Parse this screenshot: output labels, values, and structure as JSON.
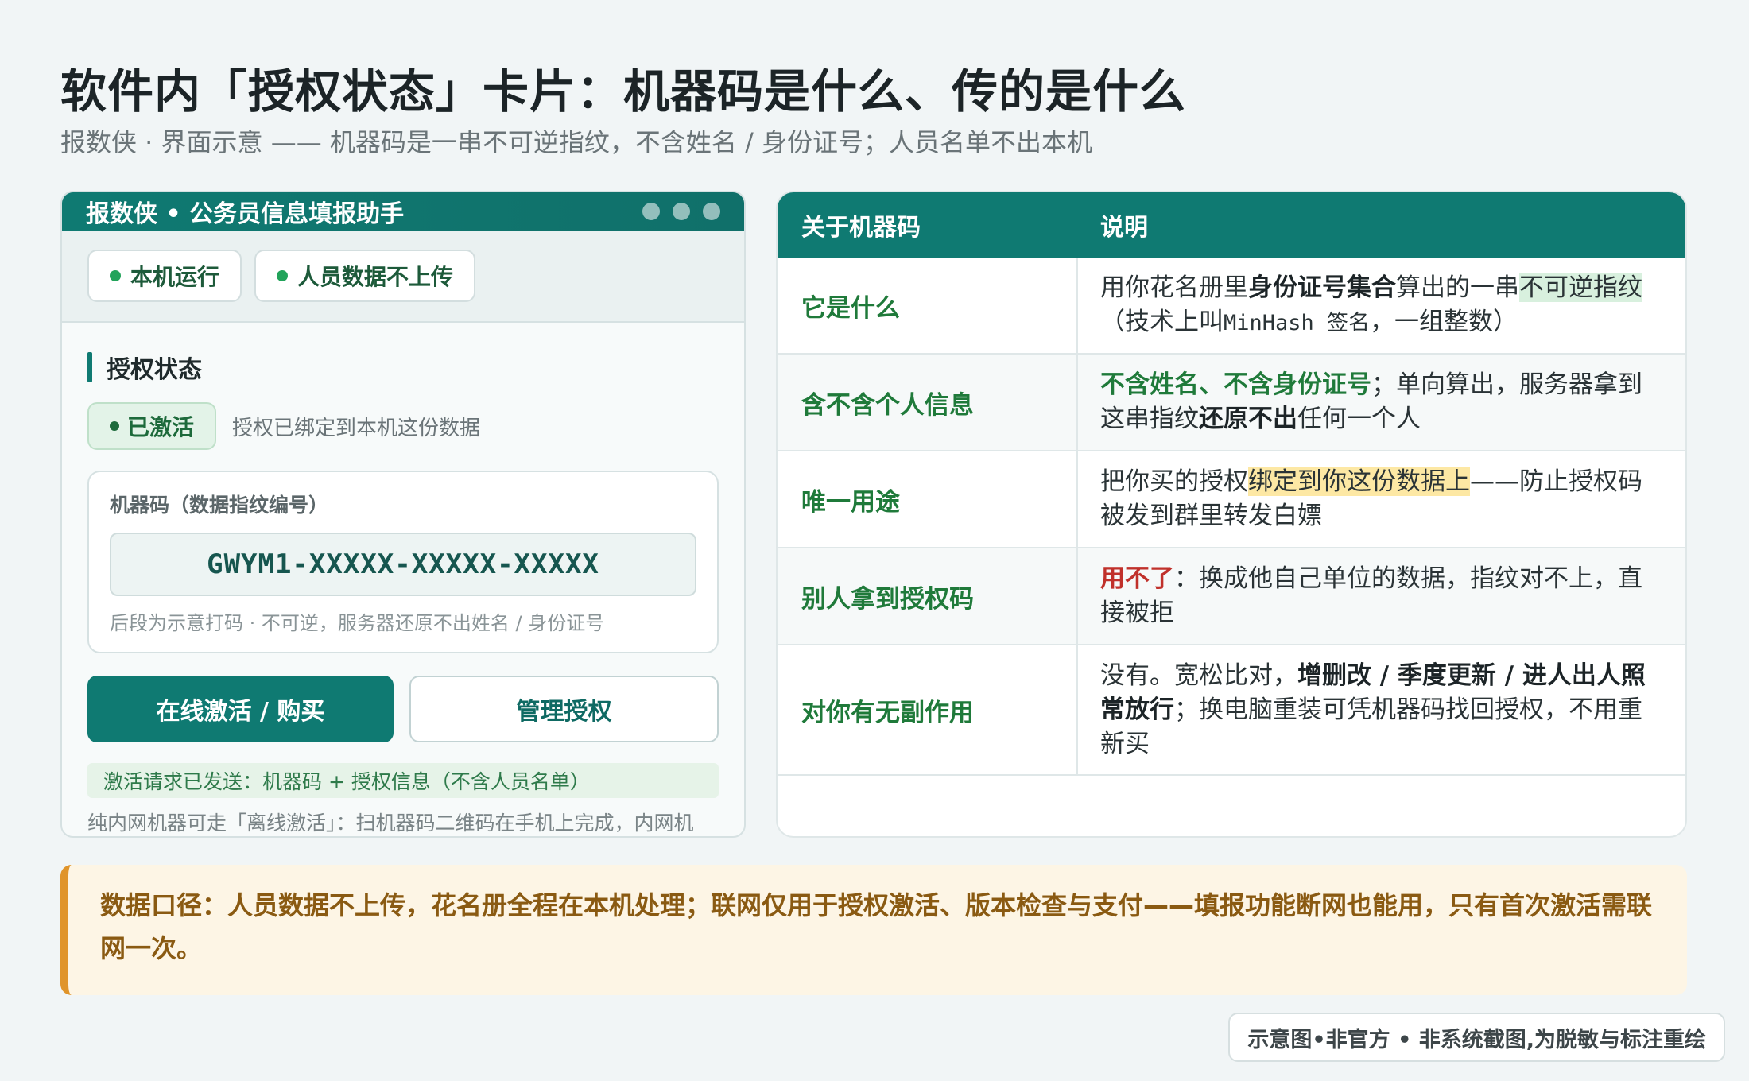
{
  "header": {
    "title": "软件内「授权状态」卡片：机器码是什么、传的是什么",
    "subtitle": "报数侠 · 界面示意 —— 机器码是一串不可逆指纹，不含姓名 / 身份证号；人员名单不出本机"
  },
  "app": {
    "window_title": "报数侠 • 公务员信息填报助手",
    "chips": [
      "本机运行",
      "人员数据不上传"
    ],
    "section_title": "授权状态",
    "status_badge": "已激活",
    "status_desc": "授权已绑定到本机这份数据",
    "machine_code_label": "机器码（数据指纹编号）",
    "machine_code_value": "GWYM1-XXXXX-XXXXX-XXXXX",
    "machine_code_hint": "后段为示意打码 · 不可逆，服务器还原不出姓名 / 身份证号",
    "btn_activate": "在线激活 / 购买",
    "btn_manage": "管理授权",
    "sent_note": "激活请求已发送：机器码 + 授权信息（不含人员名单）",
    "offline_note": "纯内网机器可走「离线激活」：扫机器码二维码在手机上完成，内网机"
  },
  "table": {
    "col1": "关于机器码",
    "col2": "说明",
    "rows": [
      {
        "key": "它是什么",
        "v1": "用你花名册里",
        "v2": "身份证号集合",
        "v3": "算出的一串",
        "v4": "不可逆指纹",
        "v5": "（技术上叫",
        "v6": "MinHash 签名",
        "v7": "，一组整数）"
      },
      {
        "key": "含不含个人信息",
        "v1": "不含姓名、不含身份证号",
        "v2": "；单向算出，服务器拿到这串指纹",
        "v3": "还原不出",
        "v4": "任何一个人"
      },
      {
        "key": "唯一用途",
        "v1": "把你买的授权",
        "v2": "绑定到你这份数据上",
        "v3": "——防止授权码被发到群里转发白嫖"
      },
      {
        "key": "别人拿到授权码",
        "v1": "用不了",
        "v2": "：换成他自己单位的数据，指纹对不上，直接被拒"
      },
      {
        "key": "对你有无副作用",
        "v1": "没有。宽松比对，",
        "v2": "增删改 / 季度更新 / 进人出人照常放行",
        "v3": "；换电脑重装可凭机器码找回授权，不用重新买"
      }
    ]
  },
  "note": "数据口径：人员数据不上传，花名册全程在本机处理；联网仅用于授权激活、版本检查与支付——填报功能断网也能用，只有首次激活需联网一次。",
  "footer": "示意图•非官方 • 非系统截图,为脱敏与标注重绘",
  "colors": {
    "accent": "#0f7a72",
    "green_text": "#1f7a3a",
    "red_text": "#c0312b",
    "note_bg": "#fdf5e5",
    "note_border": "#e0942a"
  }
}
